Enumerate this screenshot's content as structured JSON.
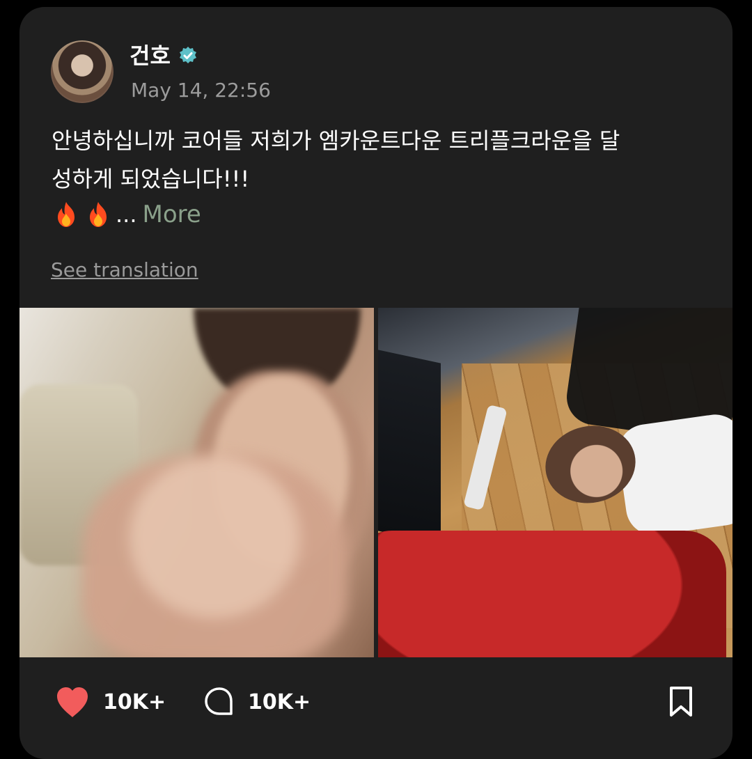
{
  "post": {
    "author": "건호",
    "timestamp": "May 14, 22:56",
    "text": "안녕하십니까 코어들 저희가 엠카운트다운 트리플크라운을 달\n성하게 되었습니다!!!",
    "more_prefix": "...",
    "more_label": "More",
    "translate_label": "See translation"
  },
  "actions": {
    "likes": "10K+",
    "comments": "10K+"
  },
  "colors": {
    "background": "#1f1f1f",
    "verified": "#5ec0c8",
    "like": "#f25c5c",
    "more": "#8aa08a"
  },
  "icons": [
    "verified-badge-icon",
    "fire-emoji-icon",
    "heart-icon",
    "comment-bubble-icon",
    "bookmark-icon"
  ]
}
